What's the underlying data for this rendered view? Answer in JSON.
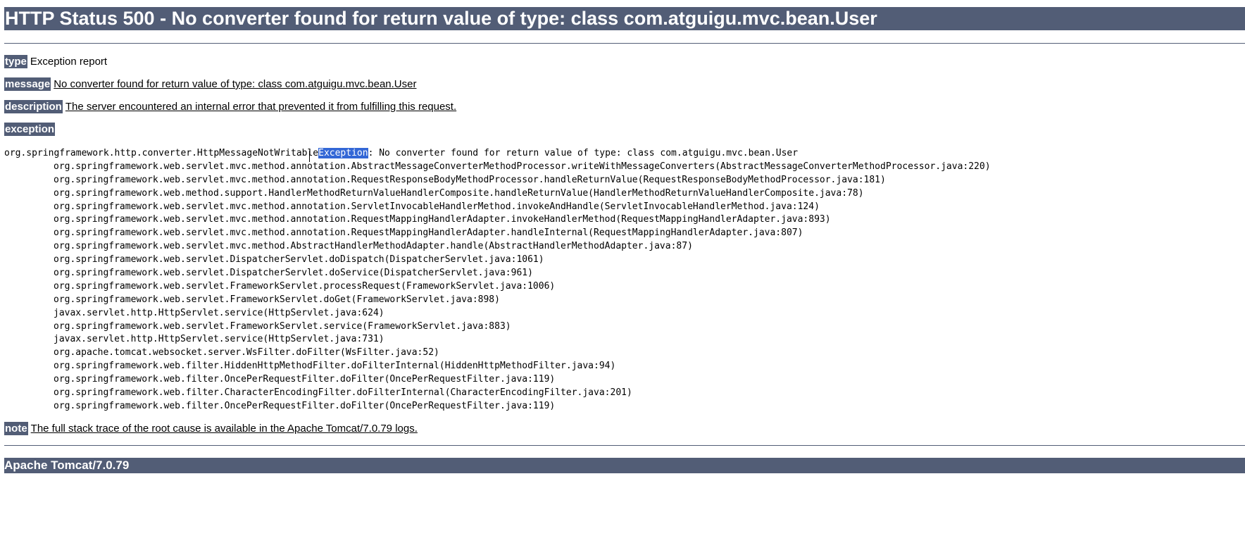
{
  "header": {
    "title": "HTTP Status 500 - No converter found for return value of type: class com.atguigu.mvc.bean.User"
  },
  "fields": {
    "type_label": "type",
    "type_value": "Exception report",
    "message_label": "message",
    "message_value": "No converter found for return value of type: class com.atguigu.mvc.bean.User",
    "description_label": "description",
    "description_value": "The server encountered an internal error that prevented it from fulfilling this request.",
    "exception_label": "exception",
    "note_label": "note",
    "note_value": "The full stack trace of the root cause is available in the Apache Tomcat/7.0.79 logs."
  },
  "exception": {
    "first_line_prefix": "org.springframework.http.converter.HttpMessageNotWritable",
    "first_line_selected": "Exception",
    "first_line_suffix": ": No converter found for return value of type: class com.atguigu.mvc.bean.User",
    "stack": [
      "org.springframework.web.servlet.mvc.method.annotation.AbstractMessageConverterMethodProcessor.writeWithMessageConverters(AbstractMessageConverterMethodProcessor.java:220)",
      "org.springframework.web.servlet.mvc.method.annotation.RequestResponseBodyMethodProcessor.handleReturnValue(RequestResponseBodyMethodProcessor.java:181)",
      "org.springframework.web.method.support.HandlerMethodReturnValueHandlerComposite.handleReturnValue(HandlerMethodReturnValueHandlerComposite.java:78)",
      "org.springframework.web.servlet.mvc.method.annotation.ServletInvocableHandlerMethod.invokeAndHandle(ServletInvocableHandlerMethod.java:124)",
      "org.springframework.web.servlet.mvc.method.annotation.RequestMappingHandlerAdapter.invokeHandlerMethod(RequestMappingHandlerAdapter.java:893)",
      "org.springframework.web.servlet.mvc.method.annotation.RequestMappingHandlerAdapter.handleInternal(RequestMappingHandlerAdapter.java:807)",
      "org.springframework.web.servlet.mvc.method.AbstractHandlerMethodAdapter.handle(AbstractHandlerMethodAdapter.java:87)",
      "org.springframework.web.servlet.DispatcherServlet.doDispatch(DispatcherServlet.java:1061)",
      "org.springframework.web.servlet.DispatcherServlet.doService(DispatcherServlet.java:961)",
      "org.springframework.web.servlet.FrameworkServlet.processRequest(FrameworkServlet.java:1006)",
      "org.springframework.web.servlet.FrameworkServlet.doGet(FrameworkServlet.java:898)",
      "javax.servlet.http.HttpServlet.service(HttpServlet.java:624)",
      "org.springframework.web.servlet.FrameworkServlet.service(FrameworkServlet.java:883)",
      "javax.servlet.http.HttpServlet.service(HttpServlet.java:731)",
      "org.apache.tomcat.websocket.server.WsFilter.doFilter(WsFilter.java:52)",
      "org.springframework.web.filter.HiddenHttpMethodFilter.doFilterInternal(HiddenHttpMethodFilter.java:94)",
      "org.springframework.web.filter.OncePerRequestFilter.doFilter(OncePerRequestFilter.java:119)",
      "org.springframework.web.filter.CharacterEncodingFilter.doFilterInternal(CharacterEncodingFilter.java:201)",
      "org.springframework.web.filter.OncePerRequestFilter.doFilter(OncePerRequestFilter.java:119)"
    ]
  },
  "footer": {
    "server": "Apache Tomcat/7.0.79"
  },
  "colors": {
    "bar": "#525d76",
    "selection": "#3367d6"
  }
}
